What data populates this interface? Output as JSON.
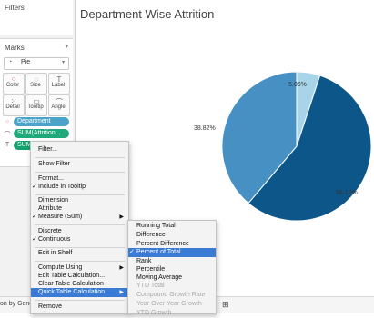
{
  "sidebar": {
    "filters_title": "Filters",
    "marks_title": "Marks",
    "mark_type": "Pie",
    "buttons": [
      {
        "label": "Color",
        "icon": "color-icon"
      },
      {
        "label": "Size",
        "icon": "size-icon"
      },
      {
        "label": "Label",
        "icon": "label-icon"
      },
      {
        "label": "Detail",
        "icon": "detail-icon"
      },
      {
        "label": "Tooltip",
        "icon": "tooltip-icon"
      },
      {
        "label": "Angle",
        "icon": "angle-icon"
      }
    ],
    "pills": [
      {
        "label": "Department",
        "icon": "color-icon"
      },
      {
        "label": "SUM(Attrition...",
        "icon": "angle-icon"
      },
      {
        "label": "SUM(Attriti...",
        "icon": "label-icon"
      }
    ]
  },
  "main": {
    "title": "Department Wise Attrition"
  },
  "chart_data": {
    "type": "pie",
    "title": "Department Wise Attrition",
    "slices": [
      {
        "label": "5.06%",
        "value": 5.06,
        "color": "#a8d4ea"
      },
      {
        "label": "56.12%",
        "value": 56.12,
        "color": "#0d5689"
      },
      {
        "label": "38.82%",
        "value": 38.82,
        "color": "#4690c3"
      }
    ]
  },
  "context_menu": {
    "items": [
      {
        "label": "Filter...",
        "checked": false
      },
      {
        "label": "Show Filter",
        "checked": false
      },
      {
        "label": "Format...",
        "checked": false
      },
      {
        "label": "Include in Tooltip",
        "checked": true
      },
      {
        "label": "Dimension",
        "checked": false
      },
      {
        "label": "Attribute",
        "checked": false
      },
      {
        "label": "Measure (Sum)",
        "checked": true,
        "submenu": true
      },
      {
        "label": "Discrete",
        "checked": false
      },
      {
        "label": "Continuous",
        "checked": true
      },
      {
        "label": "Edit in Shelf",
        "checked": false
      },
      {
        "label": "Compute Using",
        "checked": false,
        "submenu": true
      },
      {
        "label": "Edit Table Calculation...",
        "checked": false
      },
      {
        "label": "Clear Table Calculation",
        "checked": false
      },
      {
        "label": "Quick Table Calculation",
        "checked": false,
        "submenu": true,
        "highlighted": true
      },
      {
        "label": "Remove",
        "checked": false
      }
    ]
  },
  "submenu": {
    "items": [
      {
        "label": "Running Total",
        "checked": false,
        "disabled": false
      },
      {
        "label": "Difference",
        "checked": false,
        "disabled": false
      },
      {
        "label": "Percent Difference",
        "checked": false,
        "disabled": false
      },
      {
        "label": "Percent of Total",
        "checked": true,
        "disabled": false,
        "highlighted": true
      },
      {
        "label": "Rank",
        "checked": false,
        "disabled": false
      },
      {
        "label": "Percentile",
        "checked": false,
        "disabled": false
      },
      {
        "label": "Moving Average",
        "checked": false,
        "disabled": false
      },
      {
        "label": "YTD Total",
        "checked": false,
        "disabled": true
      },
      {
        "label": "Compound Growth Rate",
        "checked": false,
        "disabled": true
      },
      {
        "label": "Year Over Year Growth",
        "checked": false,
        "disabled": true
      },
      {
        "label": "YTD Growth",
        "checked": false,
        "disabled": true
      }
    ]
  },
  "marks": {
    "check": "✓",
    "submenu_arrow": "▶"
  },
  "bottom_bar": {
    "text": "on by Gende"
  }
}
